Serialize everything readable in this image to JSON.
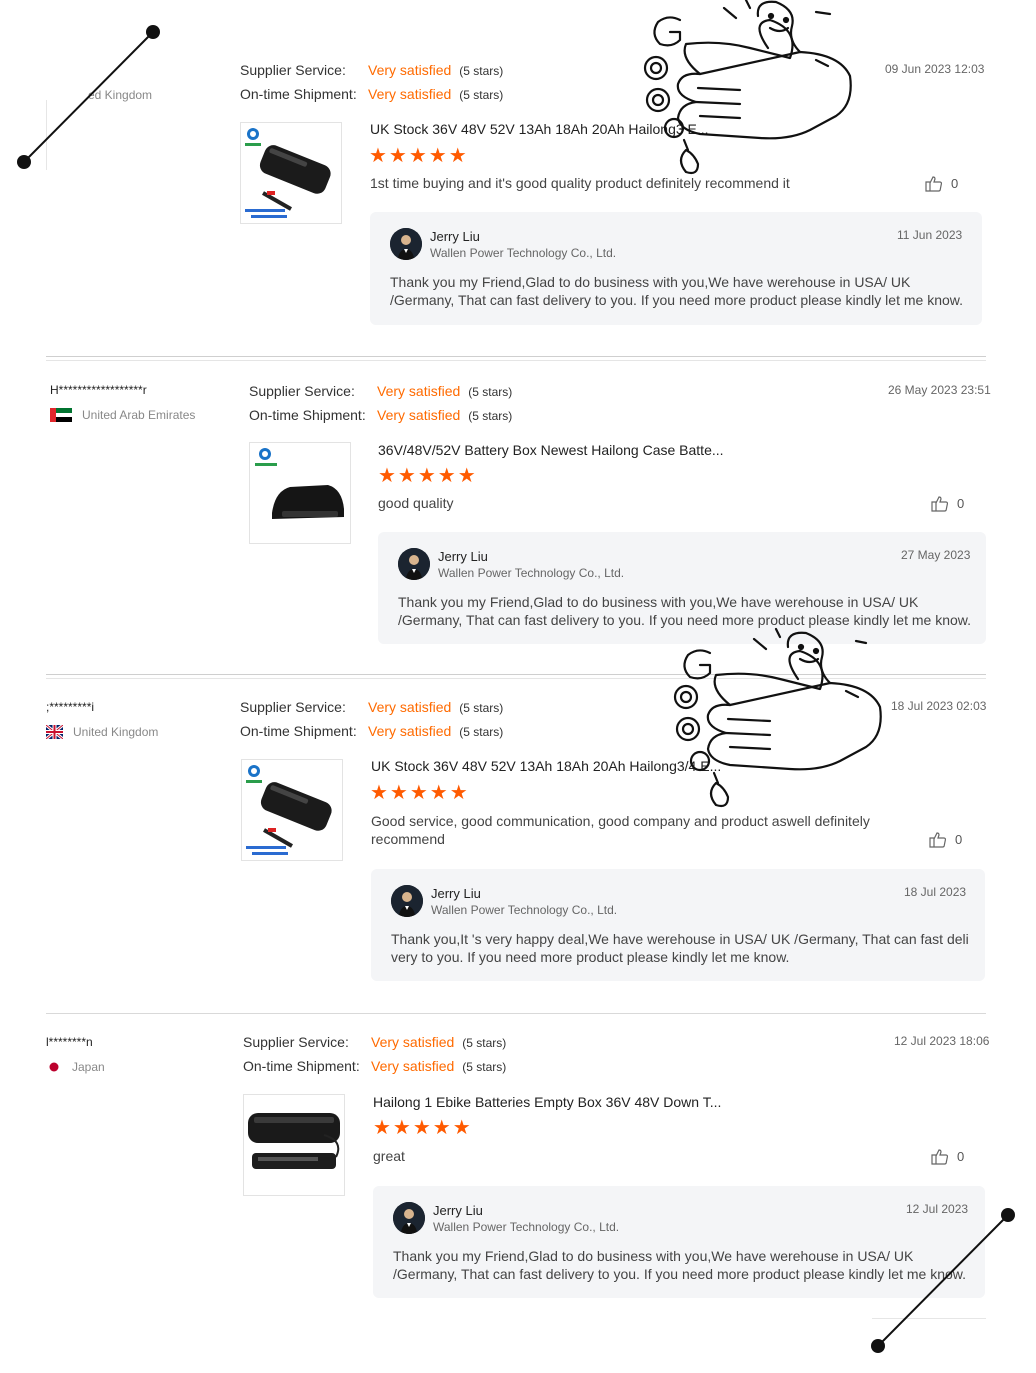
{
  "labels": {
    "supplier_service": "Supplier Service:",
    "ontime_shipment": "On-time Shipment:",
    "very_satisfied": "Very satisfied",
    "five_stars": "(5 stars)",
    "stars": "★★★★★"
  },
  "reviews": [
    {
      "buyer": "",
      "country": "ed Kingdom",
      "date": "09 Jun 2023 12:03",
      "product_title": "UK Stock 36V 48V 52V 13Ah 18Ah 20Ah Hailong3 E...",
      "text": "1st time buying and it's good quality product definitely recommend it",
      "likes": "0",
      "reply": {
        "name": "Jerry Liu",
        "company": "Wallen Power Technology Co., Ltd.",
        "date": "11 Jun 2023",
        "message": "Thank you my Friend,Glad to do business with you,We have werehouse in USA/ UK /Germany, That can fast delivery to you. If you need more product please kindly let me know."
      }
    },
    {
      "buyer": "H******************r",
      "country": "United Arab Emirates",
      "date": "26 May 2023 23:51",
      "product_title": "36V/48V/52V Battery Box Newest Hailong Case Batte...",
      "text": "good quality",
      "likes": "0",
      "reply": {
        "name": "Jerry Liu",
        "company": "Wallen Power Technology Co., Ltd.",
        "date": "27 May 2023",
        "message": "Thank you my Friend,Glad to do business with you,We have werehouse in USA/ UK /Germany, That can fast delivery to you. If you need more product please kindly let me know."
      }
    },
    {
      "buyer": ";*********i",
      "country": "United Kingdom",
      "date": "18 Jul 2023 02:03",
      "product_title": "UK Stock 36V 48V 52V 13Ah 18Ah 20Ah Hailong3/4 E...",
      "text": "Good service, good communication, good company and product aswell definitely recommend",
      "likes": "0",
      "reply": {
        "name": "Jerry Liu",
        "company": "Wallen Power Technology Co., Ltd.",
        "date": "18 Jul 2023",
        "message": "Thank you,It 's very happy deal,We have werehouse in USA/ UK /Germany, That can fast delivery to you. If you need more product please kindly let me know."
      }
    },
    {
      "buyer": "l********n",
      "country": "Japan",
      "date": "12 Jul 2023 18:06",
      "product_title": "Hailong 1 Ebike Batteries Empty Box 36V 48V Down T...",
      "text": "great",
      "likes": "0",
      "reply": {
        "name": "Jerry Liu",
        "company": "Wallen Power Technology Co., Ltd.",
        "date": "12 Jul 2023",
        "message": "Thank you my Friend,Glad to do business with you,We have werehouse in USA/ UK /Germany, That can fast delivery to you. If you need more product please kindly let me know."
      }
    }
  ],
  "colors": {
    "accent": "#ff6a00",
    "reply_bg": "#f4f5f7"
  },
  "icons": [
    "thumbs-up-icon",
    "flag-icon",
    "avatar",
    "good-sticker"
  ]
}
